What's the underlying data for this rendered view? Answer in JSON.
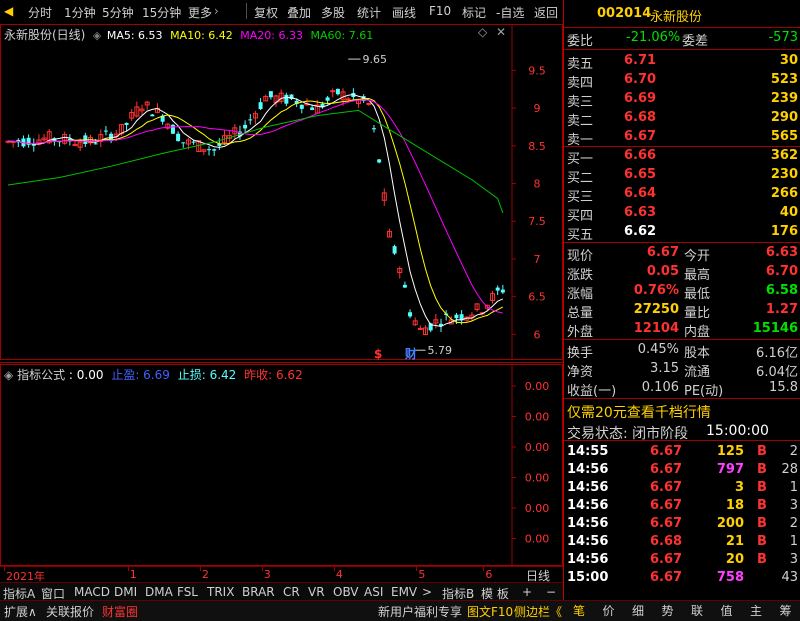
{
  "toolbar": {
    "left_items": [
      "分时",
      "1分钟",
      "5分钟",
      "15分钟",
      "更多"
    ],
    "right_items": [
      "复权",
      "叠加",
      "多股",
      "统计",
      "画线",
      "F10",
      "标记",
      "-自选",
      "返回"
    ]
  },
  "chart_header": {
    "name": "永新股份(日线)",
    "ma5": "MA5: 6.53",
    "ma10": "MA10: 6.42",
    "ma20": "MA20: 6.33",
    "ma60": "MA60: 7.61",
    "colors": {
      "ma5": "#ffffff",
      "ma10": "#ffff00",
      "ma20": "#ff00ff",
      "ma60": "#00c000",
      "up": "#ff3232",
      "down": "#54ffff"
    }
  },
  "chart_data": {
    "type": "line",
    "yticks": [
      9.5,
      9.0,
      8.5,
      8.0,
      7.5,
      7.0,
      6.5,
      6.0
    ],
    "ylim": [
      5.7,
      9.85
    ],
    "xlabels": [
      {
        "i": 0,
        "label": "2021年"
      },
      {
        "i": 24,
        "label": "1"
      },
      {
        "i": 38,
        "label": "2"
      },
      {
        "i": 50,
        "label": "3"
      },
      {
        "i": 64,
        "label": "4"
      },
      {
        "i": 80,
        "label": "5"
      },
      {
        "i": 93,
        "label": "6"
      }
    ],
    "annotations": [
      {
        "label": "9.65",
        "value": 9.65
      },
      {
        "label": "5.79",
        "value": 5.79
      }
    ],
    "markers": [
      {
        "label": "$"
      },
      {
        "label": "财"
      }
    ],
    "period": "日线",
    "ma60_line": [
      [
        0,
        7.98
      ],
      [
        10,
        8.08
      ],
      [
        20,
        8.23
      ],
      [
        30,
        8.4
      ],
      [
        40,
        8.55
      ],
      [
        50,
        8.75
      ],
      [
        60,
        8.9
      ],
      [
        68,
        8.97
      ],
      [
        72,
        8.8
      ],
      [
        78,
        8.55
      ],
      [
        84,
        8.3
      ],
      [
        90,
        8.05
      ],
      [
        95,
        7.8
      ],
      [
        96,
        7.61
      ]
    ]
  },
  "indicator": {
    "name": "指标公式",
    "value": ": 0.00",
    "stop_profit": "止盈: 6.69",
    "stop_loss": "止损: 6.42",
    "close": "昨收: 6.62",
    "yticks": [
      "0.00",
      "0.00",
      "0.00",
      "0.00",
      "0.00",
      "0.00"
    ]
  },
  "tabs": [
    "指标A",
    "窗口",
    "MACD",
    "DMI",
    "DMA",
    "FSL",
    "TRIX",
    "BRAR",
    "CR",
    "VR",
    "OBV",
    "ASI",
    "EMV",
    ">",
    "指标B",
    "模 板",
    "+",
    "−"
  ],
  "bottom_left": [
    "扩展∧",
    "关联报价",
    "财富圈"
  ],
  "bottom_mid": [
    "新用户福利专享",
    "图文F10",
    "侧边栏《"
  ],
  "bottom_right": [
    "笔",
    "价",
    "细",
    "势",
    "联",
    "值",
    "主",
    "筹"
  ],
  "stock": {
    "code": "002014",
    "name": "永新股份"
  },
  "weibi": {
    "label1": "委比",
    "v1": "-21.06%",
    "label2": "委差",
    "v2": "-573"
  },
  "asks": [
    {
      "label": "卖五",
      "price": "6.71",
      "vol": "30"
    },
    {
      "label": "卖四",
      "price": "6.70",
      "vol": "523"
    },
    {
      "label": "卖三",
      "price": "6.69",
      "vol": "239"
    },
    {
      "label": "卖二",
      "price": "6.68",
      "vol": "290"
    },
    {
      "label": "卖一",
      "price": "6.67",
      "vol": "565"
    }
  ],
  "bids": [
    {
      "label": "买一",
      "price": "6.66",
      "vol": "362"
    },
    {
      "label": "买二",
      "price": "6.65",
      "vol": "230"
    },
    {
      "label": "买三",
      "price": "6.64",
      "vol": "266"
    },
    {
      "label": "买四",
      "price": "6.63",
      "vol": "40"
    },
    {
      "label": "买五",
      "price": "6.62",
      "vol": "176"
    }
  ],
  "quote": [
    {
      "l1": "现价",
      "v1": "6.67",
      "l2": "今开",
      "v2": "6.63"
    },
    {
      "l1": "涨跌",
      "v1": "0.05",
      "l2": "最高",
      "v2": "6.70"
    },
    {
      "l1": "涨幅",
      "v1": "0.76%",
      "l2": "最低",
      "v2": "6.58"
    },
    {
      "l1": "总量",
      "v1": "27250",
      "l2": "量比",
      "v2": "1.27"
    },
    {
      "l1": "外盘",
      "v1": "12104",
      "l2": "内盘",
      "v2": "15146"
    }
  ],
  "stats": [
    {
      "l1": "换手",
      "v1": "0.45%",
      "l2": "股本",
      "v2": "6.16亿"
    },
    {
      "l1": "净资",
      "v1": "3.15",
      "l2": "流通",
      "v2": "6.04亿"
    },
    {
      "l1": "收益(一)",
      "v1": "0.106",
      "l2": "PE(动)",
      "v2": "15.8"
    }
  ],
  "promo": "仅需20元查看千档行情",
  "trade_status": {
    "label": "交易状态: 闭市阶段",
    "time": "15:00:00"
  },
  "ticks": [
    {
      "t": "14:55",
      "p": "6.67",
      "v": "125",
      "d": "B",
      "n": "2"
    },
    {
      "t": "14:56",
      "p": "6.67",
      "v": "797",
      "d": "B",
      "n": "28"
    },
    {
      "t": "14:56",
      "p": "6.67",
      "v": "3",
      "d": "B",
      "n": "1"
    },
    {
      "t": "14:56",
      "p": "6.67",
      "v": "18",
      "d": "B",
      "n": "3"
    },
    {
      "t": "14:56",
      "p": "6.67",
      "v": "200",
      "d": "B",
      "n": "2"
    },
    {
      "t": "14:56",
      "p": "6.68",
      "v": "21",
      "d": "B",
      "n": "1"
    },
    {
      "t": "14:56",
      "p": "6.67",
      "v": "20",
      "d": "B",
      "n": "3"
    },
    {
      "t": "15:00",
      "p": "6.67",
      "v": "758",
      "d": "",
      "n": "43"
    }
  ]
}
